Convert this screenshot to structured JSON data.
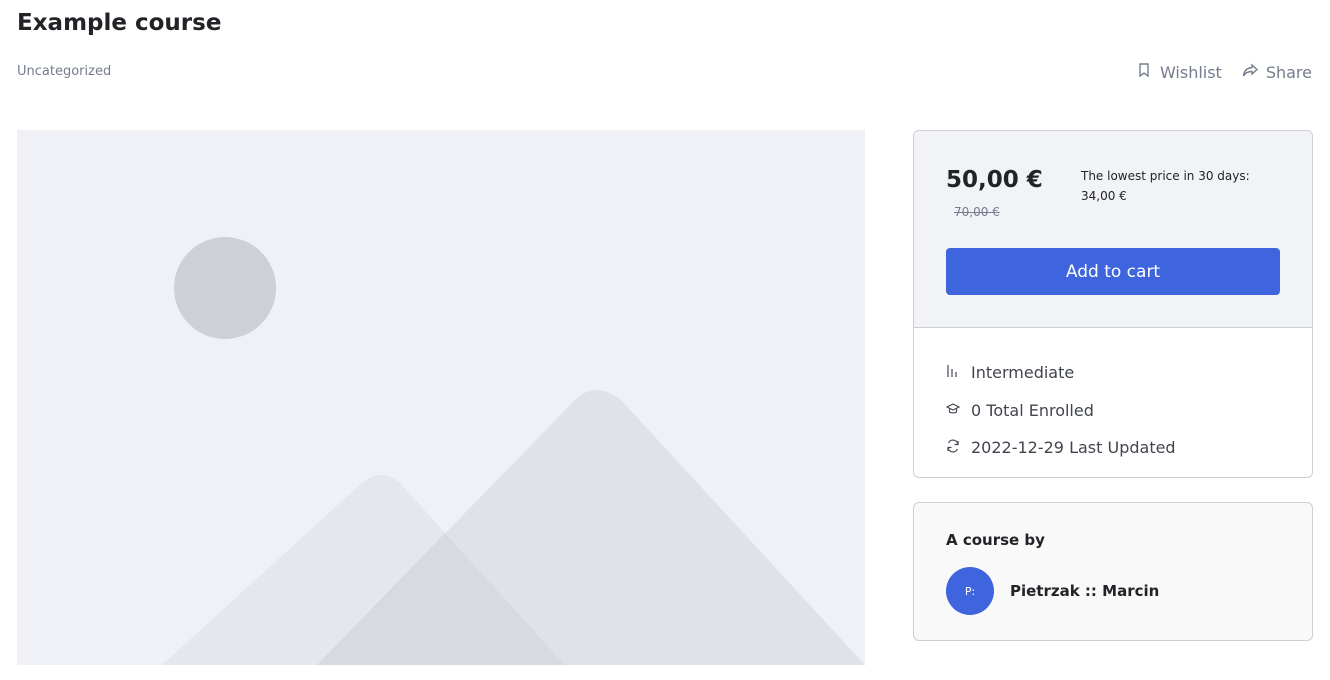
{
  "course": {
    "title": "Example course",
    "category": "Uncategorized"
  },
  "actions": {
    "wishlist_label": "Wishlist",
    "share_label": "Share"
  },
  "thumbnail": {
    "icon": "image-placeholder-icon"
  },
  "pricing": {
    "current_price": "50,00 €",
    "original_price": "70,00 €",
    "lowest_price_label": "The lowest price in 30 days:",
    "lowest_price_value": "34,00 €",
    "add_to_cart_label": "Add to cart",
    "accent_color": "#3e64de"
  },
  "meta": [
    {
      "icon": "level-bars-icon",
      "label": "Intermediate"
    },
    {
      "icon": "graduation-cap-icon",
      "label": "0 Total Enrolled"
    },
    {
      "icon": "refresh-icon",
      "label": "2022-12-29 Last Updated"
    }
  ],
  "instructor": {
    "heading": "A course by",
    "avatar_initials": "P:",
    "name": "Pietrzak :: Marcin"
  }
}
